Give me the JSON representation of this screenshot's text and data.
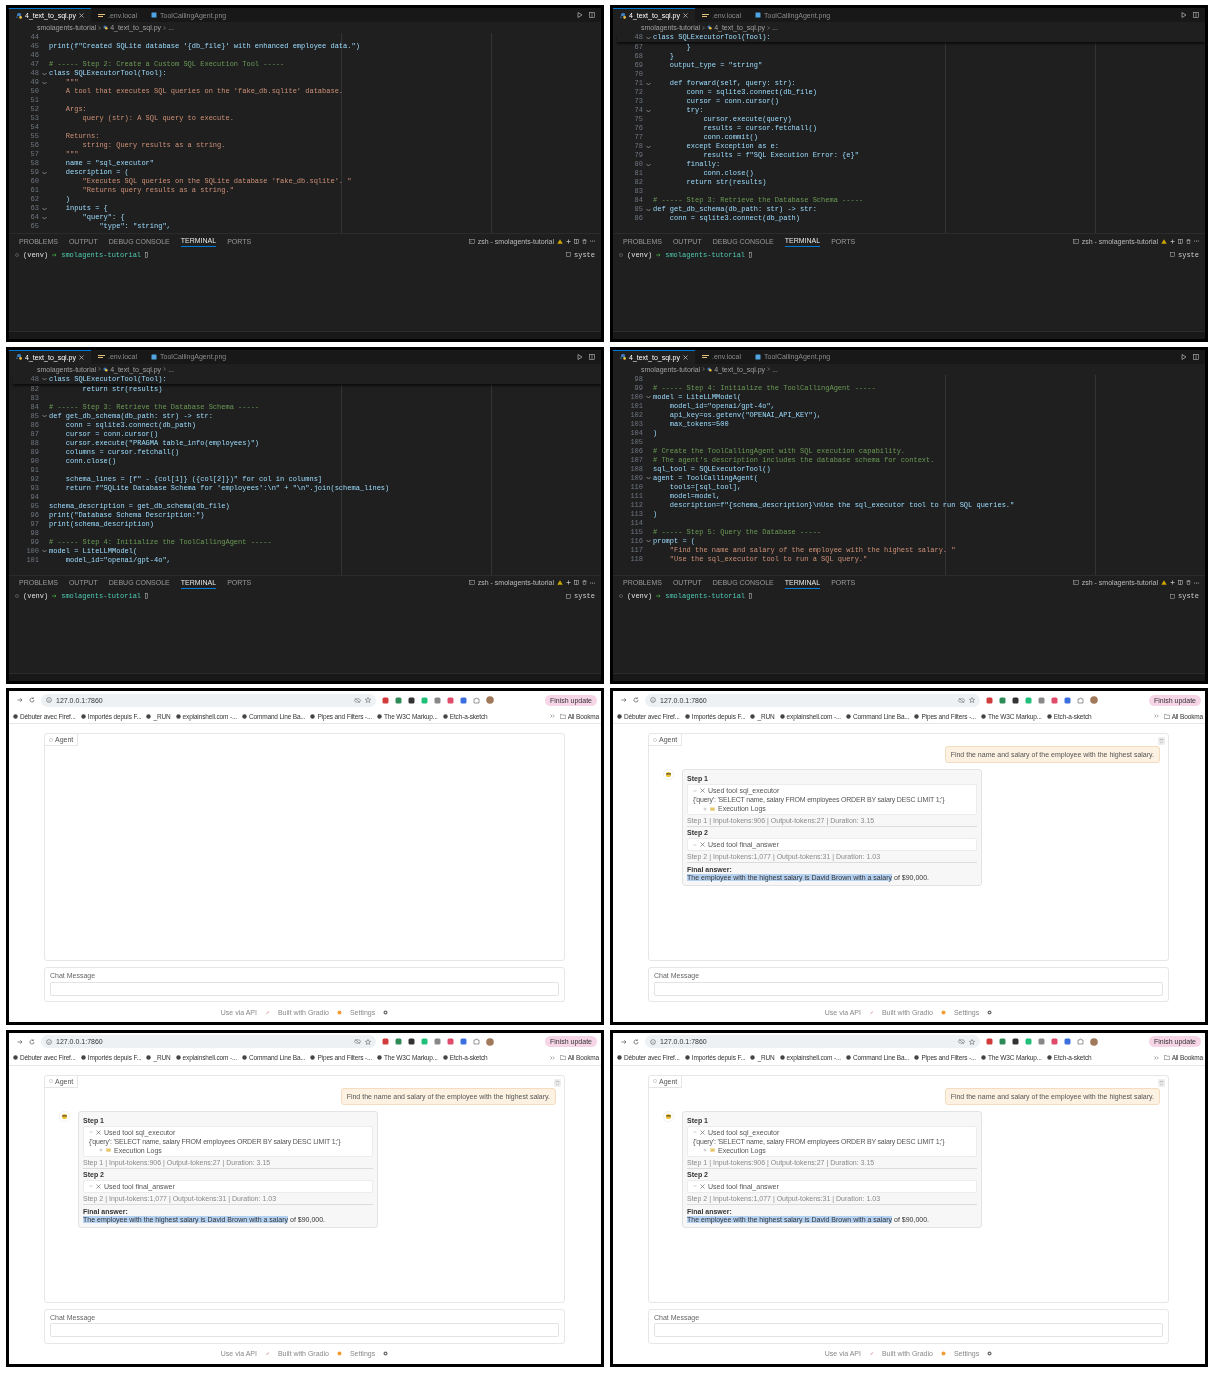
{
  "frames": [
    {
      "kind": "editor",
      "tabs": [
        {
          "label": "4_text_to_sql.py",
          "selected": true,
          "kind": "python"
        },
        {
          "label": ".env.local",
          "selected": false,
          "kind": "env"
        },
        {
          "label": "ToolCallingAgent.png",
          "selected": false,
          "kind": "image"
        }
      ],
      "breadcrumb": [
        "smolagents-tutorial",
        "4_text_to_sql.py",
        "..."
      ],
      "lines": [
        {
          "number": "44",
          "kind": "code",
          "fold": false
        },
        {
          "number": "45",
          "code": "print(f\"Created SQLite database '{db_file}' with enhanced employee data.\")",
          "kind": "code",
          "fold": false
        },
        {
          "number": "46",
          "kind": "code",
          "fold": false
        },
        {
          "number": "47",
          "code": "# ----- Step 2: Create a Custom SQL Execution Tool -----",
          "kind": "comment",
          "fold": false
        },
        {
          "number": "48",
          "code": "class SQLExecutorTool(Tool):",
          "kind": "code",
          "fold": true
        },
        {
          "number": "49",
          "code": "    \"\"\"",
          "kind": "string",
          "fold": true
        },
        {
          "number": "50",
          "code": "    A tool that executes SQL queries on the 'fake_db.sqlite' database.",
          "kind": "string",
          "fold": false
        },
        {
          "number": "51",
          "kind": "code",
          "fold": false
        },
        {
          "number": "52",
          "code": "    Args:",
          "kind": "string",
          "fold": false
        },
        {
          "number": "53",
          "code": "        query (str): A SQL query to execute.",
          "kind": "string",
          "fold": false
        },
        {
          "number": "54",
          "kind": "code",
          "fold": false
        },
        {
          "number": "55",
          "code": "    Returns:",
          "kind": "string",
          "fold": false
        },
        {
          "number": "56",
          "code": "        string: Query results as a string.",
          "kind": "string",
          "fold": false
        },
        {
          "number": "57",
          "code": "    \"\"\"",
          "kind": "string",
          "fold": false
        },
        {
          "number": "58",
          "code": "    name = \"sql_executor\"",
          "kind": "code",
          "fold": false
        },
        {
          "number": "59",
          "code": "    description = (",
          "kind": "code",
          "fold": true
        },
        {
          "number": "60",
          "code": "        \"Executes SQL queries on the SQLite database 'fake_db.sqlite'. \"",
          "kind": "string",
          "fold": false
        },
        {
          "number": "61",
          "code": "        \"Returns query results as a string.\"",
          "kind": "string",
          "fold": false
        },
        {
          "number": "62",
          "code": "    )",
          "kind": "code",
          "fold": false
        },
        {
          "number": "63",
          "code": "    inputs = {",
          "kind": "code",
          "fold": true
        },
        {
          "number": "64",
          "code": "        \"query\": {",
          "kind": "code",
          "fold": true
        },
        {
          "number": "65",
          "code": "            \"type\": \"string\",",
          "kind": "code",
          "fold": false
        }
      ],
      "panel_tabs": [
        {
          "label": "PROBLEMS",
          "selected": false
        },
        {
          "label": "OUTPUT",
          "selected": false
        },
        {
          "label": "DEBUG CONSOLE",
          "selected": false
        },
        {
          "label": "TERMINAL",
          "selected": true
        },
        {
          "label": "PORTS",
          "selected": false
        }
      ],
      "terminal": {
        "shell": "zsh - smolagents-tutorial",
        "venv": "(venv)",
        "cwd": "smolagents-tutorial",
        "side": "syste"
      }
    },
    {
      "kind": "editor",
      "tabs": [
        {
          "label": "4_text_to_sql.py",
          "selected": true,
          "kind": "python"
        },
        {
          "label": ".env.local",
          "selected": false,
          "kind": "env"
        },
        {
          "label": "ToolCallingAgent.png",
          "selected": false,
          "kind": "image"
        }
      ],
      "breadcrumb": [
        "smolagents-tutorial",
        "4_text_to_sql.py",
        "..."
      ],
      "sticky": {
        "number": "48",
        "code": "class SQLExecutorTool(Tool):",
        "kind": "code",
        "fold": true
      },
      "lines": [
        {
          "number": "67",
          "code": "        }",
          "kind": "code",
          "fold": false
        },
        {
          "number": "68",
          "code": "    }",
          "kind": "code",
          "fold": false
        },
        {
          "number": "69",
          "code": "    output_type = \"string\"",
          "kind": "code",
          "fold": false
        },
        {
          "number": "70",
          "kind": "code",
          "fold": false
        },
        {
          "number": "71",
          "code": "    def forward(self, query: str):",
          "kind": "code",
          "fold": true
        },
        {
          "number": "72",
          "code": "        conn = sqlite3.connect(db_file)",
          "kind": "code",
          "fold": false
        },
        {
          "number": "73",
          "code": "        cursor = conn.cursor()",
          "kind": "code",
          "fold": false
        },
        {
          "number": "74",
          "code": "        try:",
          "kind": "code",
          "fold": true
        },
        {
          "number": "75",
          "code": "            cursor.execute(query)",
          "kind": "code",
          "fold": false
        },
        {
          "number": "76",
          "code": "            results = cursor.fetchall()",
          "kind": "code",
          "fold": false
        },
        {
          "number": "77",
          "code": "            conn.commit()",
          "kind": "code",
          "fold": false
        },
        {
          "number": "78",
          "code": "        except Exception as e:",
          "kind": "code",
          "fold": true
        },
        {
          "number": "79",
          "code": "            results = f\"SQL Execution Error: {e}\"",
          "kind": "code",
          "fold": false
        },
        {
          "number": "80",
          "code": "        finally:",
          "kind": "code",
          "fold": true
        },
        {
          "number": "81",
          "code": "            conn.close()",
          "kind": "code",
          "fold": false
        },
        {
          "number": "82",
          "code": "        return str(results)",
          "kind": "code",
          "fold": false
        },
        {
          "number": "83",
          "kind": "code",
          "fold": false
        },
        {
          "number": "84",
          "code": "# ----- Step 3: Retrieve the Database Schema -----",
          "kind": "comment",
          "fold": false
        },
        {
          "number": "85",
          "code": "def get_db_schema(db_path: str) -> str:",
          "kind": "code",
          "fold": true
        },
        {
          "number": "86",
          "code": "    conn = sqlite3.connect(db_path)",
          "kind": "code",
          "fold": false
        }
      ],
      "panel_tabs": [
        {
          "label": "PROBLEMS",
          "selected": false
        },
        {
          "label": "OUTPUT",
          "selected": false
        },
        {
          "label": "DEBUG CONSOLE",
          "selected": false
        },
        {
          "label": "TERMINAL",
          "selected": true
        },
        {
          "label": "PORTS",
          "selected": false
        }
      ],
      "terminal": {
        "shell": "zsh - smolagents-tutorial",
        "venv": "(venv)",
        "cwd": "smolagents-tutorial",
        "side": "syste"
      }
    },
    {
      "kind": "editor",
      "tabs": [
        {
          "label": "4_text_to_sql.py",
          "selected": true,
          "kind": "python"
        },
        {
          "label": ".env.local",
          "selected": false,
          "kind": "env"
        },
        {
          "label": "ToolCallingAgent.png",
          "selected": false,
          "kind": "image"
        }
      ],
      "breadcrumb": [
        "smolagents-tutorial",
        "4_text_to_sql.py",
        "..."
      ],
      "sticky": {
        "number": "48",
        "code": "class SQLExecutorTool(Tool):",
        "kind": "code",
        "fold": true
      },
      "lines": [
        {
          "number": "82",
          "code": "        return str(results)",
          "kind": "code",
          "fold": false
        },
        {
          "number": "83",
          "kind": "code",
          "fold": false
        },
        {
          "number": "84",
          "code": "# ----- Step 3: Retrieve the Database Schema -----",
          "kind": "comment",
          "fold": false
        },
        {
          "number": "85",
          "code": "def get_db_schema(db_path: str) -> str:",
          "kind": "code",
          "fold": true
        },
        {
          "number": "86",
          "code": "    conn = sqlite3.connect(db_path)",
          "kind": "code",
          "fold": false
        },
        {
          "number": "87",
          "code": "    cursor = conn.cursor()",
          "kind": "code",
          "fold": false
        },
        {
          "number": "88",
          "code": "    cursor.execute(\"PRAGMA table_info(employees)\")",
          "kind": "code",
          "fold": false
        },
        {
          "number": "89",
          "code": "    columns = cursor.fetchall()",
          "kind": "code",
          "fold": false
        },
        {
          "number": "90",
          "code": "    conn.close()",
          "kind": "code",
          "fold": false
        },
        {
          "number": "91",
          "kind": "code",
          "fold": false
        },
        {
          "number": "92",
          "code": "    schema_lines = [f\" - {col[1]} ({col[2]})\" for col in columns]",
          "kind": "code",
          "fold": false
        },
        {
          "number": "93",
          "code": "    return f\"SQLite Database Schema for 'employees':\\n\" + \"\\n\".join(schema_lines)",
          "kind": "code",
          "fold": false
        },
        {
          "number": "94",
          "kind": "code",
          "fold": false
        },
        {
          "number": "95",
          "code": "schema_description = get_db_schema(db_file)",
          "kind": "code",
          "fold": false
        },
        {
          "number": "96",
          "code": "print(\"Database Schema Description:\")",
          "kind": "code",
          "fold": false
        },
        {
          "number": "97",
          "code": "print(schema_description)",
          "kind": "code",
          "fold": false
        },
        {
          "number": "98",
          "kind": "code",
          "fold": false
        },
        {
          "number": "99",
          "code": "# ----- Step 4: Initialize the ToolCallingAgent -----",
          "kind": "comment",
          "fold": false
        },
        {
          "number": "100",
          "code": "model = LiteLLMModel(",
          "kind": "code",
          "fold": true
        },
        {
          "number": "101",
          "code": "    model_id=\"openai/gpt-4o\",",
          "kind": "code",
          "fold": false
        }
      ],
      "panel_tabs": [
        {
          "label": "PROBLEMS",
          "selected": false
        },
        {
          "label": "OUTPUT",
          "selected": false
        },
        {
          "label": "DEBUG CONSOLE",
          "selected": false
        },
        {
          "label": "TERMINAL",
          "selected": true
        },
        {
          "label": "PORTS",
          "selected": false
        }
      ],
      "terminal": {
        "shell": "zsh - smolagents-tutorial",
        "venv": "(venv)",
        "cwd": "smolagents-tutorial",
        "side": "syste"
      }
    },
    {
      "kind": "editor",
      "tabs": [
        {
          "label": "4_text_to_sql.py",
          "selected": true,
          "kind": "python"
        },
        {
          "label": ".env.local",
          "selected": false,
          "kind": "env"
        },
        {
          "label": "ToolCallingAgent.png",
          "selected": false,
          "kind": "image"
        }
      ],
      "breadcrumb": [
        "smolagents-tutorial",
        "4_text_to_sql.py",
        "..."
      ],
      "lines": [
        {
          "number": "98",
          "kind": "code",
          "fold": false
        },
        {
          "number": "99",
          "code": "# ----- Step 4: Initialize the ToolCallingAgent -----",
          "kind": "comment",
          "fold": false
        },
        {
          "number": "100",
          "code": "model = LiteLLMModel(",
          "kind": "code",
          "fold": true
        },
        {
          "number": "101",
          "code": "    model_id=\"openai/gpt-4o\",",
          "kind": "code",
          "fold": false
        },
        {
          "number": "102",
          "code": "    api_key=os.getenv(\"OPENAI_API_KEY\"),",
          "kind": "code",
          "fold": false
        },
        {
          "number": "103",
          "code": "    max_tokens=500",
          "kind": "code",
          "fold": false
        },
        {
          "number": "104",
          "code": ")",
          "kind": "code",
          "fold": false
        },
        {
          "number": "105",
          "kind": "code",
          "fold": false
        },
        {
          "number": "106",
          "code": "# Create the ToolCallingAgent with SQL execution capability.",
          "kind": "comment",
          "fold": false
        },
        {
          "number": "107",
          "code": "# The agent's description includes the database schema for context.",
          "kind": "comment",
          "fold": false
        },
        {
          "number": "108",
          "code": "sql_tool = SQLExecutorTool()",
          "kind": "code",
          "fold": false
        },
        {
          "number": "109",
          "code": "agent = ToolCallingAgent(",
          "kind": "code",
          "fold": true
        },
        {
          "number": "110",
          "code": "    tools=[sql_tool],",
          "kind": "code",
          "fold": false
        },
        {
          "number": "111",
          "code": "    model=model,",
          "kind": "code",
          "fold": false
        },
        {
          "number": "112",
          "code": "    description=f\"{schema_description}\\nUse the sql_executor tool to run SQL queries.\"",
          "kind": "code",
          "fold": false
        },
        {
          "number": "113",
          "code": ")",
          "kind": "code",
          "fold": false
        },
        {
          "number": "114",
          "kind": "code",
          "fold": false
        },
        {
          "number": "115",
          "code": "# ----- Step 5: Query the Database -----",
          "kind": "comment",
          "fold": false
        },
        {
          "number": "116",
          "code": "prompt = (",
          "kind": "code",
          "fold": true
        },
        {
          "number": "117",
          "code": "    \"Find the name and salary of the employee with the highest salary. \"",
          "kind": "string",
          "fold": false
        },
        {
          "number": "118",
          "code": "    \"Use the sql_executor tool to run a SQL query.\"",
          "kind": "string",
          "fold": false
        }
      ],
      "panel_tabs": [
        {
          "label": "PROBLEMS",
          "selected": false
        },
        {
          "label": "OUTPUT",
          "selected": false
        },
        {
          "label": "DEBUG CONSOLE",
          "selected": false
        },
        {
          "label": "TERMINAL",
          "selected": true
        },
        {
          "label": "PORTS",
          "selected": false
        }
      ],
      "terminal": {
        "shell": "zsh - smolagents-tutorial",
        "venv": "(venv)",
        "cwd": "smolagents-tutorial",
        "side": "syste"
      }
    },
    {
      "kind": "browser",
      "url": "127.0.0.1:7860",
      "update_button": "Finish update",
      "bookmarks": [
        "Débuter avec Firef...",
        "Importés depuis F...",
        "_RUN",
        "explainshell.com -...",
        "Command Line Ba...",
        "Pipes and Filters -...",
        "The W3C Markup...",
        "Etch-a-sketch"
      ],
      "all_bookmarks": "All Bookma",
      "chatbot_label": "Agent",
      "clear_button": false,
      "input_label": "Chat Message",
      "footer": [
        "Use via API",
        "Built with Gradio",
        "Settings"
      ]
    },
    {
      "kind": "browser",
      "url": "127.0.0.1:7860",
      "update_button": "Finish update",
      "bookmarks": [
        "Débuter avec Firef...",
        "Importés depuis F...",
        "_RUN",
        "explainshell.com -...",
        "Command Line Ba...",
        "Pipes and Filters -...",
        "The W3C Markup...",
        "Etch-a-sketch"
      ],
      "all_bookmarks": "All Bookma",
      "chatbot_label": "Agent",
      "clear_button": true,
      "messages": [
        {
          "kind": "user",
          "text": "Find the name and salary of the employee with the highest salary."
        },
        {
          "kind": "agent",
          "steps": [
            {
              "title": "Step 1",
              "tool": "Used tool sql_executor",
              "arguments": "{'query': 'SELECT name, salary FROM employees ORDER BY salary DESC LIMIT 1;'}",
              "logs": "Execution Logs",
              "stats": "Step 1 | Input-tokens:906 | Output-tokens:27 | Duration: 3.15"
            },
            {
              "title": "Step 2",
              "tool": "Used tool final_answer",
              "stats": "Step 2 | Input-tokens:1,077 | Output-tokens:31 | Duration: 1.03"
            }
          ],
          "final_label": "Final answer:",
          "answer": [
            {
              "text": "The employee with the highest salary is David Brown with a salary",
              "selected": true
            },
            {
              "text": " of $90,000.",
              "selected": false
            }
          ]
        }
      ],
      "input_label": "Chat Message",
      "footer": [
        "Use via API",
        "Built with Gradio",
        "Settings"
      ]
    },
    {
      "kind": "browser",
      "url": "127.0.0.1:7860",
      "update_button": "Finish update",
      "bookmarks": [
        "Débuter avec Firef...",
        "Importés depuis F...",
        "_RUN",
        "explainshell.com -...",
        "Command Line Ba...",
        "Pipes and Filters -...",
        "The W3C Markup...",
        "Etch-a-sketch"
      ],
      "all_bookmarks": "All Bookma",
      "chatbot_label": "Agent",
      "clear_button": true,
      "messages": [
        {
          "kind": "user",
          "text": "Find the name and salary of the employee with the highest salary."
        },
        {
          "kind": "agent",
          "steps": [
            {
              "title": "Step 1",
              "tool": "Used tool sql_executor",
              "arguments": "{'query': 'SELECT name, salary FROM employees ORDER BY salary DESC LIMIT 1;'}",
              "logs": "Execution Logs",
              "stats": "Step 1 | Input-tokens:906 | Output-tokens:27 | Duration: 3.15"
            },
            {
              "title": "Step 2",
              "tool": "Used tool final_answer",
              "stats": "Step 2 | Input-tokens:1,077 | Output-tokens:31 | Duration: 1.03"
            }
          ],
          "final_label": "Final answer:",
          "answer": [
            {
              "text": "The employee with the highest salary is David Brown with a salary",
              "selected": true
            },
            {
              "text": " of $90,000.",
              "selected": false
            }
          ]
        }
      ],
      "input_label": "Chat Message",
      "footer": [
        "Use via API",
        "Built with Gradio",
        "Settings"
      ]
    },
    {
      "kind": "browser",
      "url": "127.0.0.1:7860",
      "update_button": "Finish update",
      "bookmarks": [
        "Débuter avec Firef...",
        "Importés depuis F...",
        "_RUN",
        "explainshell.com -...",
        "Command Line Ba...",
        "Pipes and Filters -...",
        "The W3C Markup...",
        "Etch-a-sketch"
      ],
      "all_bookmarks": "All Bookma",
      "chatbot_label": "Agent",
      "clear_button": true,
      "messages": [
        {
          "kind": "user",
          "text": "Find the name and salary of the employee with the highest salary."
        },
        {
          "kind": "agent",
          "steps": [
            {
              "title": "Step 1",
              "tool": "Used tool sql_executor",
              "arguments": "{'query': 'SELECT name, salary FROM employees ORDER BY salary DESC LIMIT 1;'}",
              "logs": "Execution Logs",
              "stats": "Step 1 | Input-tokens:906 | Output-tokens:27 | Duration: 3.15"
            },
            {
              "title": "Step 2",
              "tool": "Used tool final_answer",
              "stats": "Step 2 | Input-tokens:1,077 | Output-tokens:31 | Duration: 1.03"
            }
          ],
          "final_label": "Final answer:",
          "answer": [
            {
              "text": "The employee with the highest salary is David Brown with a salary",
              "selected": true
            },
            {
              "text": " of $90,000.",
              "selected": false
            }
          ]
        }
      ],
      "input_label": "Chat Message",
      "footer": [
        "Use via API",
        "Built with Gradio",
        "Settings"
      ]
    }
  ]
}
